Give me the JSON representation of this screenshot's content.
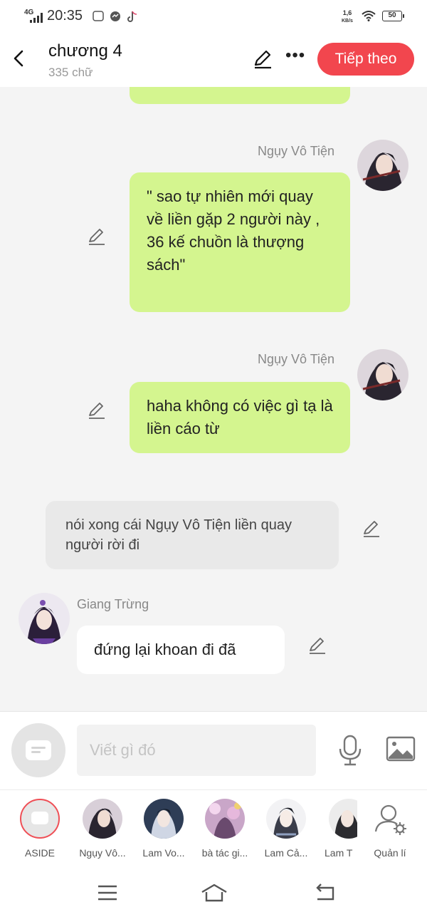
{
  "status_bar": {
    "network": "4G",
    "time": "20:35",
    "speed_value": "1,6",
    "speed_unit": "KB/s",
    "battery": "50"
  },
  "header": {
    "title": "chương 4",
    "subtitle": "335 chữ",
    "next_label": "Tiếp theo"
  },
  "messages": [
    {
      "type": "right",
      "author": "Ngụy Vô Tiện",
      "text": "\" sao tự nhiên mới quay về liền gặp 2 người này , 36 kế chuồn là thượng sách\""
    },
    {
      "type": "right",
      "author": "Ngụy Vô Tiện",
      "text": "haha không có việc gì tạ là liền cáo từ"
    },
    {
      "type": "narration",
      "text": "nói xong cái Ngụy Vô Tiện liền quay người rời đi"
    },
    {
      "type": "left",
      "author": "Giang Trừng",
      "text": "đứng lại khoan đi đã"
    }
  ],
  "input": {
    "placeholder": "Viết gì đó"
  },
  "characters": [
    {
      "label": "ASIDE"
    },
    {
      "label": "Ngụy Vô..."
    },
    {
      "label": "Lam Vo..."
    },
    {
      "label": "bà tác gi..."
    },
    {
      "label": "Lam Cả..."
    },
    {
      "label": "Lam T"
    },
    {
      "label": "Quản lí"
    }
  ],
  "colors": {
    "accent": "#f2464e",
    "bubble_green": "#d4f58f",
    "bubble_gray": "#e9e9e9"
  }
}
